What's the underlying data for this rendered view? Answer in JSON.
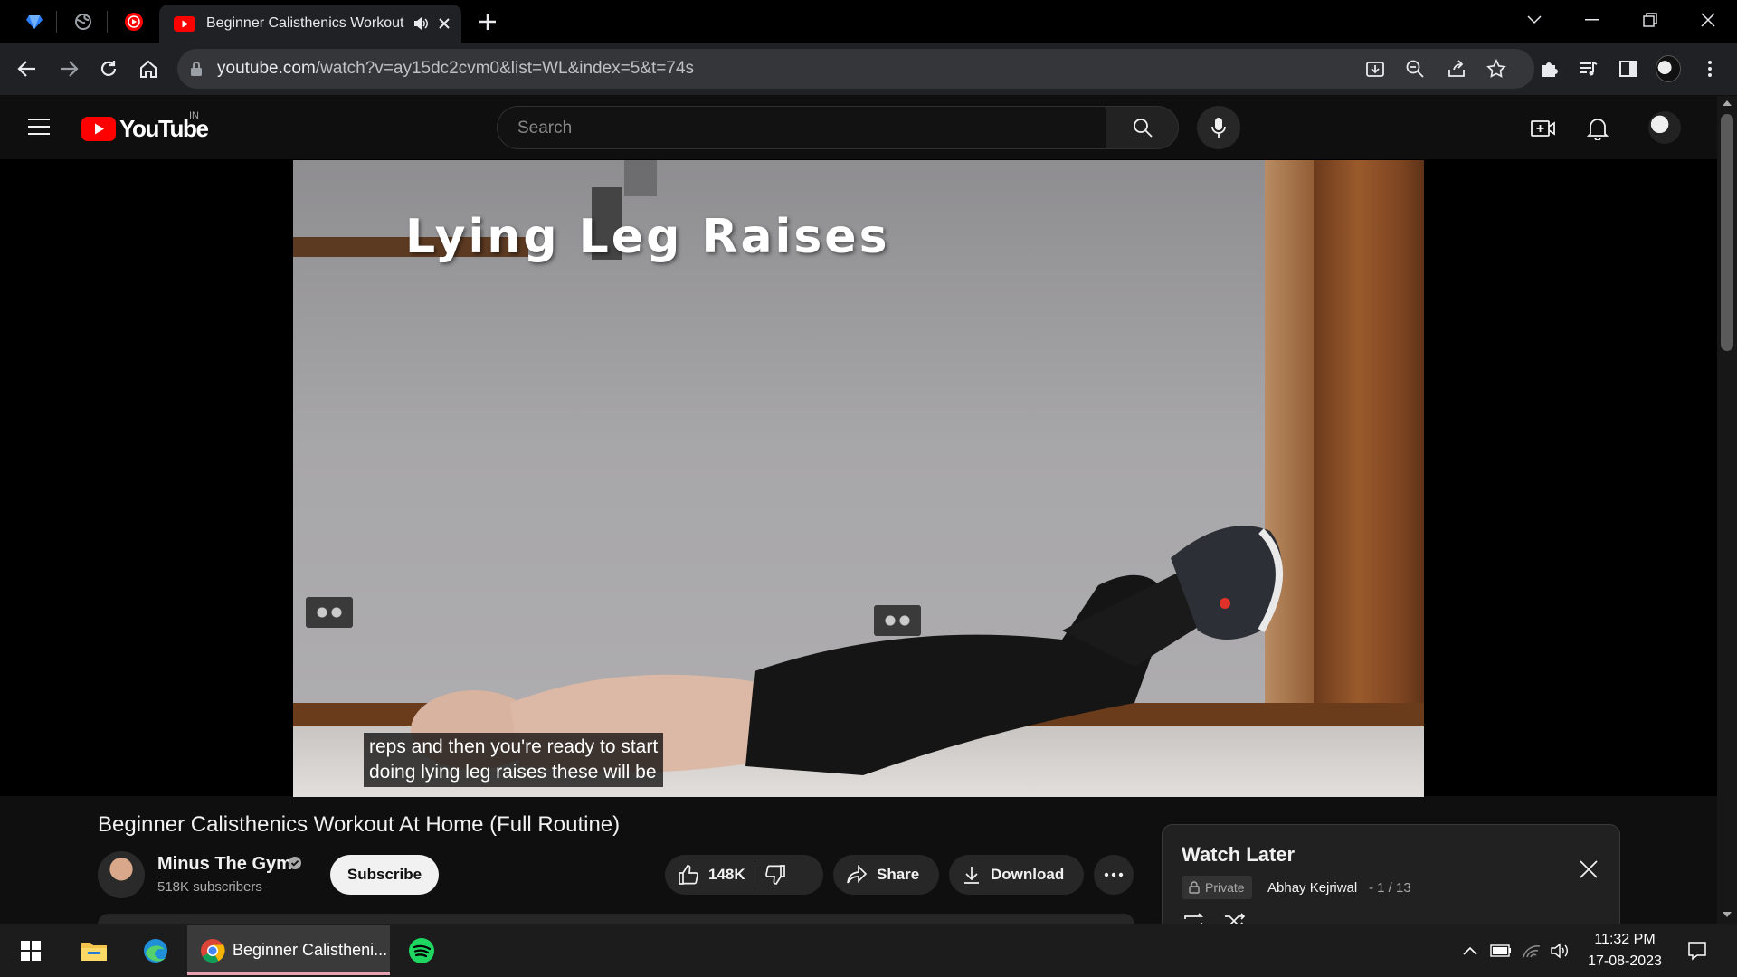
{
  "browser": {
    "tab_title": "Beginner Calisthenics Workout At Home (Full Routine)",
    "url_host": "youtube.com",
    "url_path": "/watch?v=ay15dc2cvm0&list=WL&index=5&t=74s"
  },
  "youtube": {
    "logo_text": "YouTube",
    "country": "IN",
    "search_placeholder": "Search"
  },
  "video": {
    "overlay_title": "Lying Leg Raises",
    "caption_line1": "reps and then you're ready to start",
    "caption_line2": "doing lying leg raises these will be"
  },
  "details": {
    "title": "Beginner Calisthenics Workout At Home (Full Routine)",
    "channel": "Minus The Gym",
    "subscribers": "518K subscribers",
    "subscribe_label": "Subscribe",
    "likes": "148K",
    "share_label": "Share",
    "download_label": "Download"
  },
  "playlist": {
    "title": "Watch Later",
    "privacy": "Private",
    "owner": "Abhay Kejriwal",
    "position": "- 1 / 13"
  },
  "taskbar": {
    "active_app_label": "Beginner Calistheni...",
    "time": "11:32 PM",
    "date": "17-08-2023"
  },
  "colors": {
    "yt_red": "#ff0000",
    "page_bg": "#0f0f0f",
    "chip_bg": "#272727"
  }
}
